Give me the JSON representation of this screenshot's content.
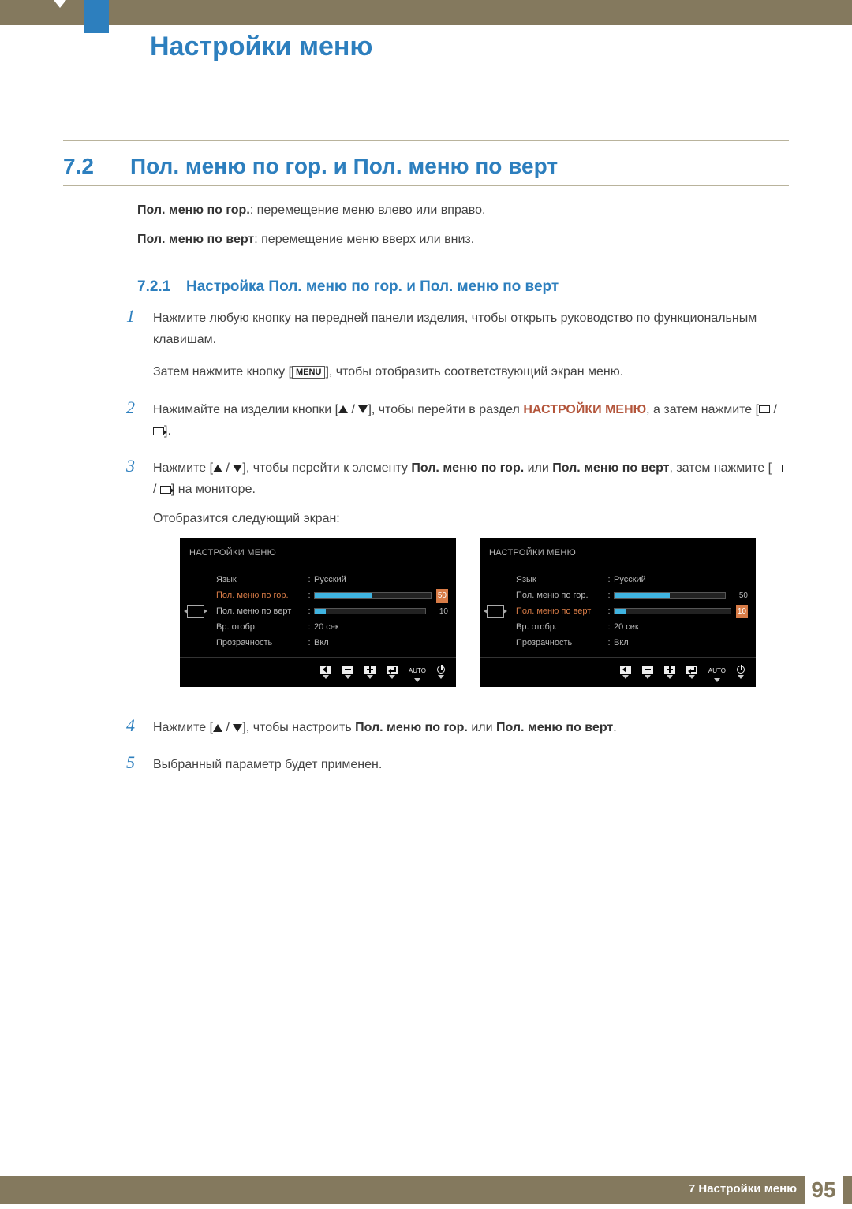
{
  "header": {
    "title": "Настройки меню"
  },
  "section": {
    "num": "7.2",
    "title": "Пол. меню по гор. и Пол. меню по верт"
  },
  "intro": {
    "p1_bold": "Пол. меню по гор.",
    "p1_rest": ": перемещение меню влево или вправо.",
    "p2_bold": "Пол. меню по верт",
    "p2_rest": ": перемещение меню вверх или вниз."
  },
  "subsection": {
    "num": "7.2.1",
    "title": "Настройка Пол. меню по гор. и Пол. меню по верт"
  },
  "steps": {
    "s1_num": "1",
    "s1a": "Нажмите любую кнопку на передней панели изделия, чтобы открыть руководство по функциональным клавишам.",
    "s1b_pre": "Затем нажмите кнопку [",
    "s1b_menu": "MENU",
    "s1b_post": "], чтобы отобразить соответствующий экран меню.",
    "s2_num": "2",
    "s2_pre": "Нажимайте на изделии кнопки [",
    "s2_mid": "], чтобы перейти в раздел ",
    "s2_section": "НАСТРОЙКИ МЕНЮ",
    "s2_tail_pre": ", а затем нажмите [",
    "s2_tail_post": "].",
    "s3_num": "3",
    "s3_pre": "Нажмите [",
    "s3_mid": "], чтобы перейти к элементу ",
    "s3_opt1": "Пол. меню по гор.",
    "s3_or": " или ",
    "s3_opt2": "Пол. меню по верт",
    "s3_tail_pre": ", затем нажмите [",
    "s3_tail_post": "] на мониторе.",
    "s3_last": "Отобразится следующий экран:",
    "s4_num": "4",
    "s4_pre": "Нажмите [",
    "s4_mid": "], чтобы настроить ",
    "s4_opt1": "Пол. меню по гор.",
    "s4_or": " или ",
    "s4_opt2": "Пол. меню по верт",
    "s4_end": ".",
    "s5_num": "5",
    "s5": "Выбранный параметр будет применен."
  },
  "osd": {
    "title": "НАСТРОЙКИ МЕНЮ",
    "rows": {
      "lang_label": "Язык",
      "lang_val": "Русский",
      "hpos_label": "Пол. меню по гор.",
      "hpos_val": "50",
      "vpos_label": "Пол. меню по верт",
      "vpos_val": "10",
      "time_label": "Вр. отобр.",
      "time_val": "20 сек",
      "trans_label": "Прозрачность",
      "trans_val": "Вкл"
    },
    "footer_auto": "AUTO"
  },
  "footer": {
    "chapter": "7 Настройки меню",
    "page": "95"
  }
}
